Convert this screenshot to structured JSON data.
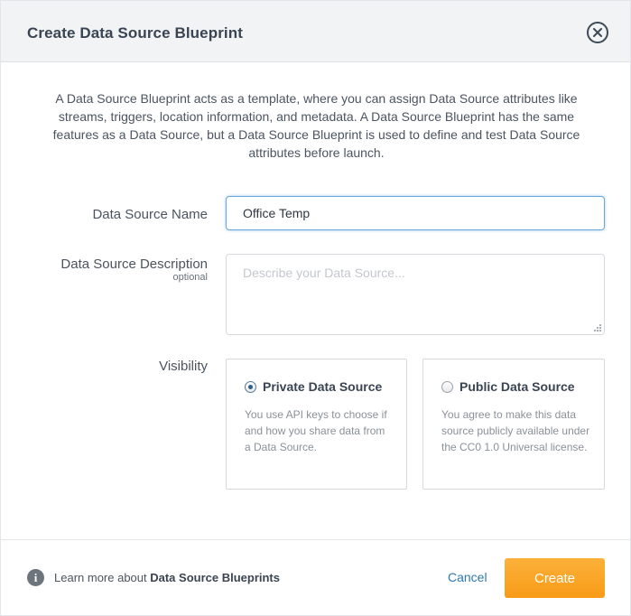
{
  "dialog": {
    "title": "Create Data Source Blueprint",
    "intro": "A Data Source Blueprint acts as a template, where you can assign Data Source attributes like streams, triggers, location information, and metadata. A Data Source Blueprint has the same features as a Data Source, but a Data Source Blueprint is used to define and test Data Source attributes before launch."
  },
  "form": {
    "name_label": "Data Source Name",
    "name_value": "Office Temp",
    "description_label": "Data Source Description",
    "description_optional": "optional",
    "description_placeholder": "Describe your Data Source...",
    "visibility_label": "Visibility",
    "visibility_options": [
      {
        "title": "Private Data Source",
        "text": "You use API keys to choose if and how you share data from a Data Source.",
        "selected": true
      },
      {
        "title": "Public Data Source",
        "text": "You agree to make this data source publicly available under the CC0 1.0 Universal license.",
        "selected": false
      }
    ]
  },
  "footer": {
    "learn_prefix": "Learn more about ",
    "learn_link": "Data Source Blueprints",
    "cancel_label": "Cancel",
    "create_label": "Create"
  },
  "colors": {
    "primary_button": "#f9a326",
    "link": "#2f78b3",
    "header_bg": "#f1f3f5",
    "focus_border": "#69a6dc"
  },
  "icons": {
    "close": "close-circle-icon",
    "info": "info-circle-icon",
    "resize": "resize-grip-icon"
  }
}
